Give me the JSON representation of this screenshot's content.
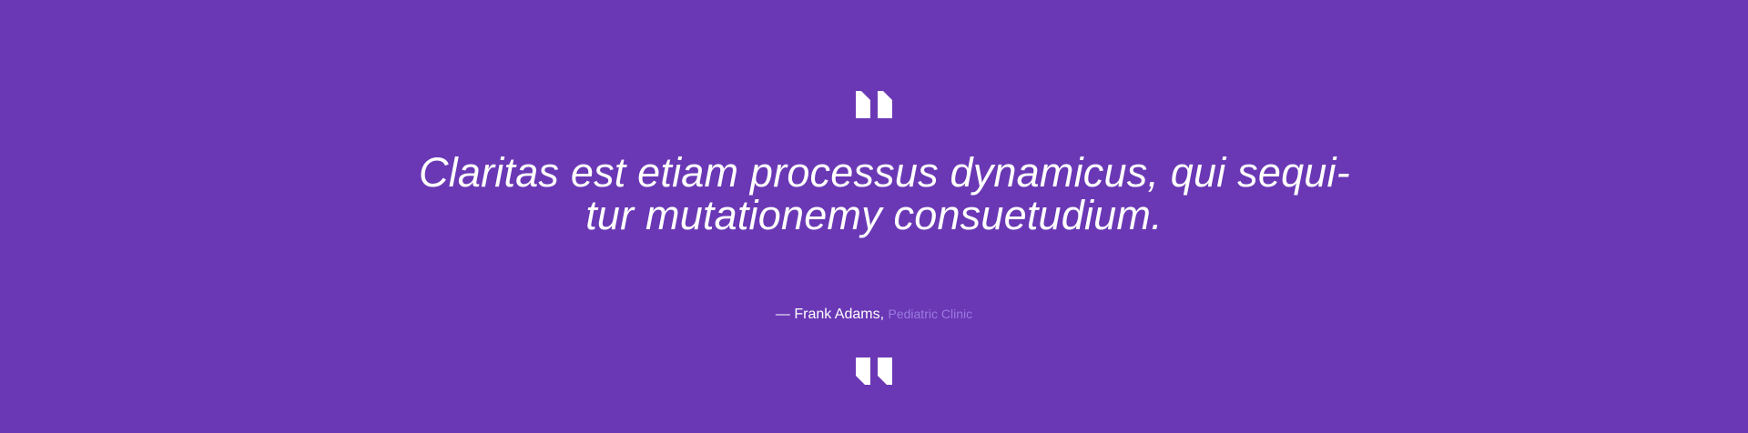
{
  "testimonial": {
    "open_quote_icon": "quote-open-icon",
    "quote_lines": [
      "Claritas est etiam processus dynamicus, qui sequi-",
      "tur mutationemy consuetudium."
    ],
    "author_prefix": "— ",
    "author_name": "Frank Adams,",
    "author_org": "Pediatric Clinic",
    "close_quote_icon": "quote-close-icon"
  },
  "colors": {
    "background": "#6a38b5",
    "text": "#ffffff",
    "org_text": "#9b7ae0"
  }
}
